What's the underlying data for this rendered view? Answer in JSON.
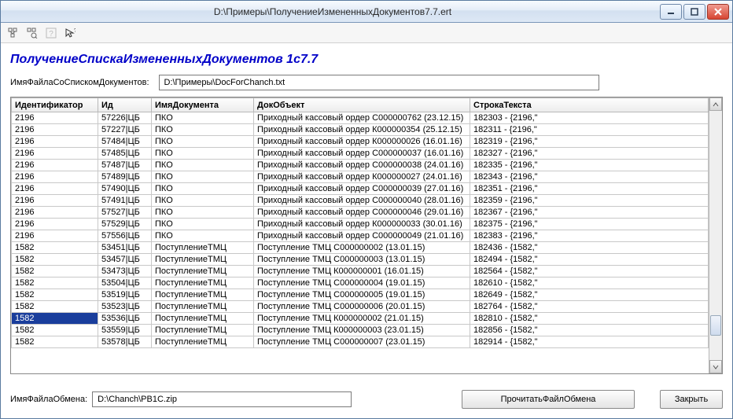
{
  "window": {
    "title": "D:\\Примеры\\ПолучениеИзмененныхДокументов7.7.ert"
  },
  "heading": "ПолучениеСпискаИзмененныхДокументов 1с7.7",
  "fileListLabel": "ИмяФайлаСоСпискомДокументов:",
  "fileListValue": "D:\\Примеры\\DocForChanch.txt",
  "columns": {
    "ident": "Идентификатор",
    "id": "Ид",
    "name": "ИмяДокумента",
    "obj": "ДокОбъект",
    "text": "СтрокаТекста"
  },
  "rows": [
    {
      "ident": "2196",
      "id": "57226|ЦБ",
      "name": "ПКО",
      "obj": "Приходный кассовый ордер С000000762 (23.12.15)",
      "text": "182303 - {2196,\""
    },
    {
      "ident": "2196",
      "id": "57227|ЦБ",
      "name": "ПКО",
      "obj": "Приходный кассовый ордер К000000354 (25.12.15)",
      "text": "182311 - {2196,\""
    },
    {
      "ident": "2196",
      "id": "57484|ЦБ",
      "name": "ПКО",
      "obj": "Приходный кассовый ордер К000000026 (16.01.16)",
      "text": "182319 - {2196,\""
    },
    {
      "ident": "2196",
      "id": "57485|ЦБ",
      "name": "ПКО",
      "obj": "Приходный кассовый ордер С000000037 (16.01.16)",
      "text": "182327 - {2196,\""
    },
    {
      "ident": "2196",
      "id": "57487|ЦБ",
      "name": "ПКО",
      "obj": "Приходный кассовый ордер С000000038 (24.01.16)",
      "text": "182335 - {2196,\""
    },
    {
      "ident": "2196",
      "id": "57489|ЦБ",
      "name": "ПКО",
      "obj": "Приходный кассовый ордер К000000027 (24.01.16)",
      "text": "182343 - {2196,\""
    },
    {
      "ident": "2196",
      "id": "57490|ЦБ",
      "name": "ПКО",
      "obj": "Приходный кассовый ордер С000000039 (27.01.16)",
      "text": "182351 - {2196,\""
    },
    {
      "ident": "2196",
      "id": "57491|ЦБ",
      "name": "ПКО",
      "obj": "Приходный кассовый ордер С000000040 (28.01.16)",
      "text": "182359 - {2196,\""
    },
    {
      "ident": "2196",
      "id": "57527|ЦБ",
      "name": "ПКО",
      "obj": "Приходный кассовый ордер С000000046 (29.01.16)",
      "text": "182367 - {2196,\""
    },
    {
      "ident": "2196",
      "id": "57529|ЦБ",
      "name": "ПКО",
      "obj": "Приходный кассовый ордер К000000033 (30.01.16)",
      "text": "182375 - {2196,\""
    },
    {
      "ident": "2196",
      "id": "57556|ЦБ",
      "name": "ПКО",
      "obj": "Приходный кассовый ордер С000000049 (21.01.16)",
      "text": "182383 - {2196,\""
    },
    {
      "ident": "1582",
      "id": "53451|ЦБ",
      "name": "ПоступлениеТМЦ",
      "obj": "Поступление ТМЦ С000000002 (13.01.15)",
      "text": "182436 - {1582,\""
    },
    {
      "ident": "1582",
      "id": "53457|ЦБ",
      "name": "ПоступлениеТМЦ",
      "obj": "Поступление ТМЦ С000000003 (13.01.15)",
      "text": "182494 - {1582,\""
    },
    {
      "ident": "1582",
      "id": "53473|ЦБ",
      "name": "ПоступлениеТМЦ",
      "obj": "Поступление ТМЦ К000000001 (16.01.15)",
      "text": "182564 - {1582,\""
    },
    {
      "ident": "1582",
      "id": "53504|ЦБ",
      "name": "ПоступлениеТМЦ",
      "obj": "Поступление ТМЦ С000000004 (19.01.15)",
      "text": "182610 - {1582,\""
    },
    {
      "ident": "1582",
      "id": "53519|ЦБ",
      "name": "ПоступлениеТМЦ",
      "obj": "Поступление ТМЦ С000000005 (19.01.15)",
      "text": "182649 - {1582,\""
    },
    {
      "ident": "1582",
      "id": "53523|ЦБ",
      "name": "ПоступлениеТМЦ",
      "obj": "Поступление ТМЦ С000000006 (20.01.15)",
      "text": "182764 - {1582,\""
    },
    {
      "ident": "1582",
      "id": "53536|ЦБ",
      "name": "ПоступлениеТМЦ",
      "obj": "Поступление ТМЦ К000000002 (21.01.15)",
      "text": "182810 - {1582,\"",
      "selected": true
    },
    {
      "ident": "1582",
      "id": "53559|ЦБ",
      "name": "ПоступлениеТМЦ",
      "obj": "Поступление ТМЦ К000000003 (23.01.15)",
      "text": "182856 - {1582,\""
    },
    {
      "ident": "1582",
      "id": "53578|ЦБ",
      "name": "ПоступлениеТМЦ",
      "obj": "Поступление ТМЦ С000000007 (23.01.15)",
      "text": "182914 - {1582,\""
    }
  ],
  "exchangeLabel": "ИмяФайлаОбмена:",
  "exchangeValue": "D:\\Chanch\\PB1C.zip",
  "buttons": {
    "read": "ПрочитатьФайлОбмена",
    "close": "Закрыть"
  }
}
